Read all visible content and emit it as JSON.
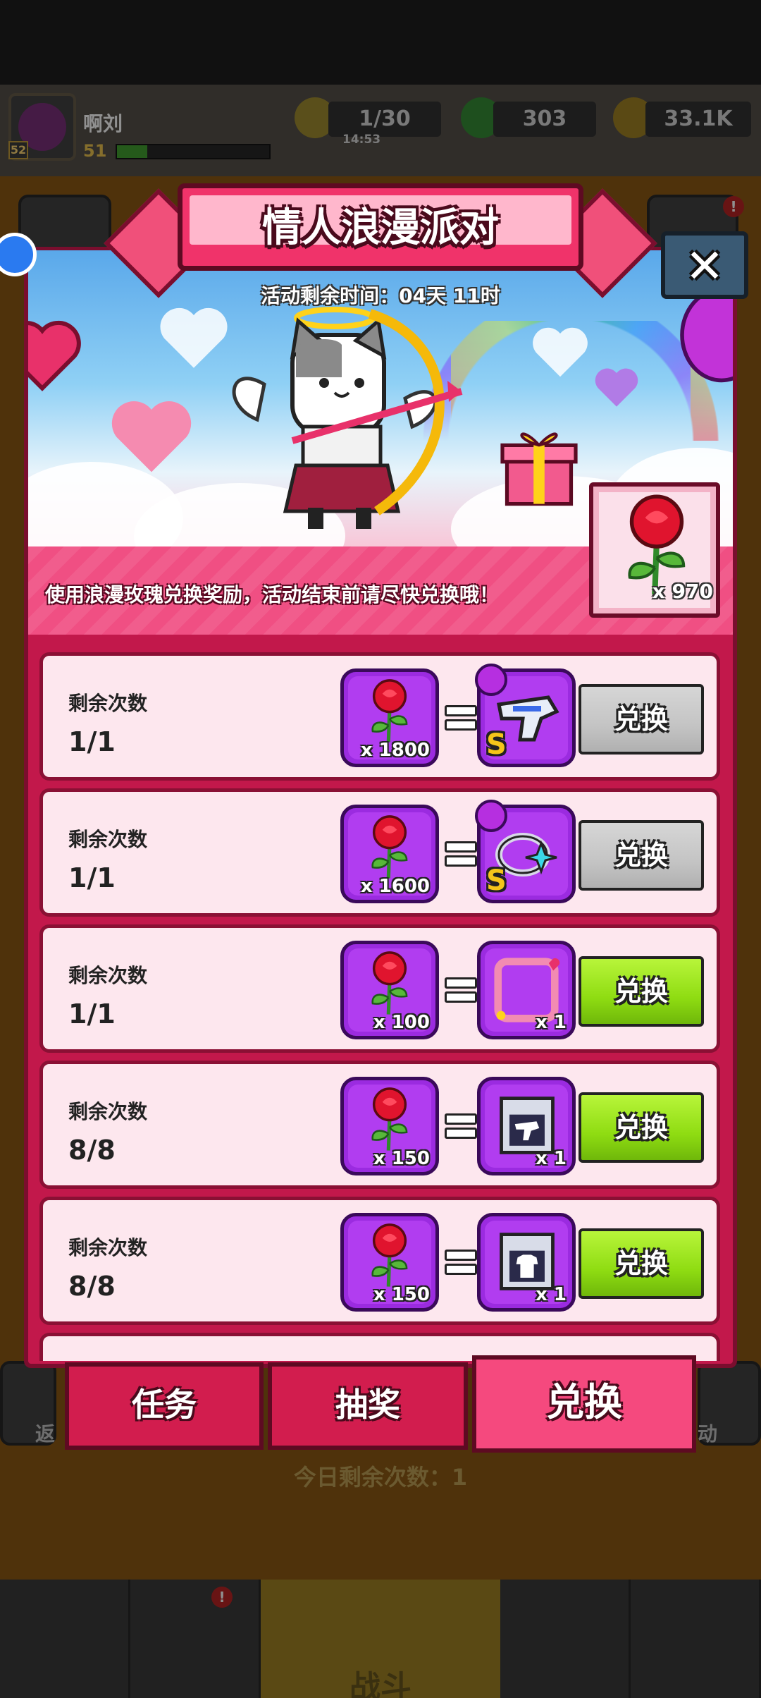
{
  "hud": {
    "player_name": "啊刘",
    "level": "51",
    "avatar_level": "52",
    "energy": "1/30",
    "energy_timer": "14:53",
    "gems": "303",
    "coins": "33.1K",
    "xp_progress": 0.2
  },
  "background": {
    "back_label": "返",
    "activity_label": "动",
    "daily_remaining": "今日剩余次数：1",
    "battle_label": "战斗",
    "badge_mark": "!"
  },
  "modal": {
    "title": "情人浪漫派对",
    "close_icon": "✕",
    "time_left": "活动剩余时间：04天 11时",
    "info": "使用浪漫玫瑰兑换奖励，活动结束前请尽快兑换哦！",
    "rose_owned": "x 970"
  },
  "rows": [
    {
      "label": "剩余次数",
      "count": "1/1",
      "cost": "x 1800",
      "reward_qty": "",
      "reward_icon": "pistol-weapon-icon",
      "reward_grade": "S",
      "button": "兑换",
      "button_state": "disabled"
    },
    {
      "label": "剩余次数",
      "count": "1/1",
      "cost": "x 1600",
      "reward_qty": "",
      "reward_icon": "ring-accessory-icon",
      "reward_grade": "S",
      "button": "兑换",
      "button_state": "disabled"
    },
    {
      "label": "剩余次数",
      "count": "1/1",
      "cost": "x 100",
      "reward_qty": "x 1",
      "reward_icon": "avatar-frame-icon",
      "reward_grade": "",
      "button": "兑换",
      "button_state": "enabled"
    },
    {
      "label": "剩余次数",
      "count": "8/8",
      "cost": "x 150",
      "reward_qty": "x 1",
      "reward_icon": "weapon-chest-icon",
      "reward_grade": "",
      "button": "兑换",
      "button_state": "enabled"
    },
    {
      "label": "剩余次数",
      "count": "8/8",
      "cost": "x 150",
      "reward_qty": "x 1",
      "reward_icon": "armor-chest-icon",
      "reward_grade": "",
      "button": "兑换",
      "button_state": "enabled"
    }
  ],
  "tabs": [
    {
      "label": "任务",
      "active": false
    },
    {
      "label": "抽奖",
      "active": false
    },
    {
      "label": "兑换",
      "active": true
    }
  ],
  "colors": {
    "modal": "#c2184b",
    "accent_pink": "#f04f83",
    "button_green": "#8fdc12",
    "button_gray": "#c4c4c4",
    "slot_purple": "#9b2be0"
  }
}
